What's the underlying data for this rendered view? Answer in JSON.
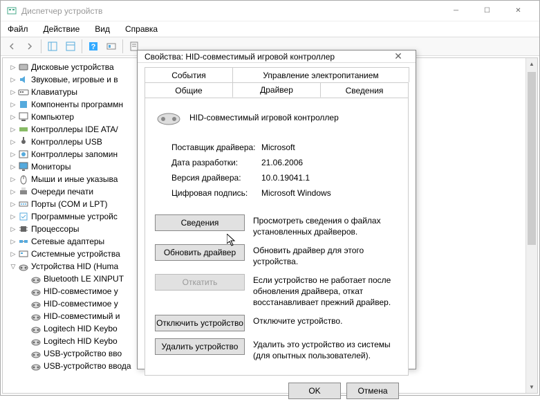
{
  "main": {
    "title": "Диспетчер устройств",
    "menu": [
      "Файл",
      "Действие",
      "Вид",
      "Справка"
    ]
  },
  "tree": {
    "items": [
      {
        "label": "Дисковые устройства",
        "icon": "disk",
        "expandable": true
      },
      {
        "label": "Звуковые, игровые и в",
        "icon": "audio",
        "expandable": true
      },
      {
        "label": "Клавиатуры",
        "icon": "keyboard",
        "expandable": true
      },
      {
        "label": "Компоненты программн",
        "icon": "component",
        "expandable": true
      },
      {
        "label": "Компьютер",
        "icon": "computer",
        "expandable": true
      },
      {
        "label": "Контроллеры IDE ATA/",
        "icon": "ide",
        "expandable": true
      },
      {
        "label": "Контроллеры USB",
        "icon": "usb",
        "expandable": true
      },
      {
        "label": "Контроллеры запомин",
        "icon": "storage",
        "expandable": true
      },
      {
        "label": "Мониторы",
        "icon": "monitor",
        "expandable": true
      },
      {
        "label": "Мыши и иные указыва",
        "icon": "mouse",
        "expandable": true
      },
      {
        "label": "Очереди печати",
        "icon": "printer",
        "expandable": true
      },
      {
        "label": "Порты (COM и LPT)",
        "icon": "port",
        "expandable": true
      },
      {
        "label": "Программные устройс",
        "icon": "software",
        "expandable": true
      },
      {
        "label": "Процессоры",
        "icon": "cpu",
        "expandable": true
      },
      {
        "label": "Сетевые адаптеры",
        "icon": "network",
        "expandable": true
      },
      {
        "label": "Системные устройства",
        "icon": "system",
        "expandable": true
      }
    ],
    "expanded": {
      "label": "Устройства HID (Huma",
      "children": [
        "Bluetooth LE XINPUT",
        "HID-совместимое у",
        "HID-совместимое у",
        "HID-совместимый и",
        "Logitech HID Keybo",
        "Logitech HID Keybo",
        "USB-устройство вво",
        "USB-устройство ввода"
      ]
    }
  },
  "dialog": {
    "title": "Свойства: HID-совместимый игровой контроллер",
    "tabs": {
      "row1": [
        "События",
        "Управление электропитанием"
      ],
      "row2": [
        "Общие",
        "Драйвер",
        "Сведения"
      ],
      "active": "Драйвер"
    },
    "device_name": "HID-совместимый игровой контроллер",
    "info": {
      "provider_label": "Поставщик драйвера:",
      "provider_value": "Microsoft",
      "date_label": "Дата разработки:",
      "date_value": "21.06.2006",
      "version_label": "Версия драйвера:",
      "version_value": "10.0.19041.1",
      "signature_label": "Цифровая подпись:",
      "signature_value": "Microsoft Windows"
    },
    "buttons": {
      "details": {
        "label": "Сведения",
        "desc": "Просмотреть сведения о файлах установленных драйверов."
      },
      "update": {
        "label": "Обновить драйвер",
        "desc": "Обновить драйвер для этого устройства."
      },
      "rollback": {
        "label": "Откатить",
        "desc": "Если устройство не работает после обновления драйвера, откат восстанавливает прежний драйвер."
      },
      "disable": {
        "label": "Отключить устройство",
        "desc": "Отключите устройство."
      },
      "uninstall": {
        "label": "Удалить устройство",
        "desc": "Удалить это устройство из системы (для опытных пользователей)."
      }
    },
    "footer": {
      "ok": "OK",
      "cancel": "Отмена"
    }
  }
}
